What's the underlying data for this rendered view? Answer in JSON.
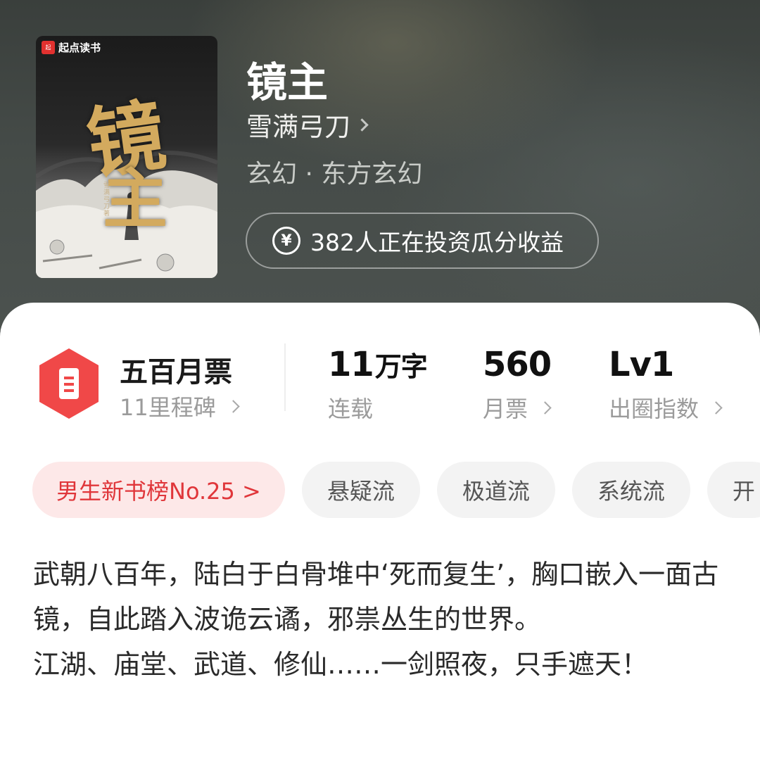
{
  "book": {
    "title": "镜主",
    "author": "雪满弓刀",
    "genre": "玄幻 · 东方玄幻",
    "invest_label": "382人正在投资瓜分收益",
    "cover": {
      "logo_text": "起点读书",
      "title_char_1": "镜",
      "title_char_2": "主",
      "author_small": "雪满弓刀 著"
    }
  },
  "stats": {
    "milestone": {
      "title": "五百月票",
      "sub": "11里程碑"
    },
    "words": {
      "value": "11",
      "unit": "万字",
      "label": "连载"
    },
    "votes": {
      "value": "560",
      "label": "月票"
    },
    "circle": {
      "value": "Lv1",
      "label": "出圈指数"
    }
  },
  "tags": [
    {
      "label": "男生新书榜No.25 >"
    },
    {
      "label": "悬疑流"
    },
    {
      "label": "极道流"
    },
    {
      "label": "系统流"
    },
    {
      "label": "开"
    }
  ],
  "description": {
    "para1": "武朝八百年，陆白于白骨堆中‘死而复生’，胸口嵌入一面古镜，自此踏入波诡云谲，邪祟丛生的世界。",
    "para2": "江湖、庙堂、武道、修仙……一剑照夜，只手遮天！"
  },
  "icons": [
    "chevron-right-icon",
    "yen-icon",
    "ticket-badge-icon"
  ],
  "colors": {
    "rank_tag_text": "#e0363a",
    "rank_tag_bg": "#fde8e8",
    "badge_red": "#f04848"
  }
}
